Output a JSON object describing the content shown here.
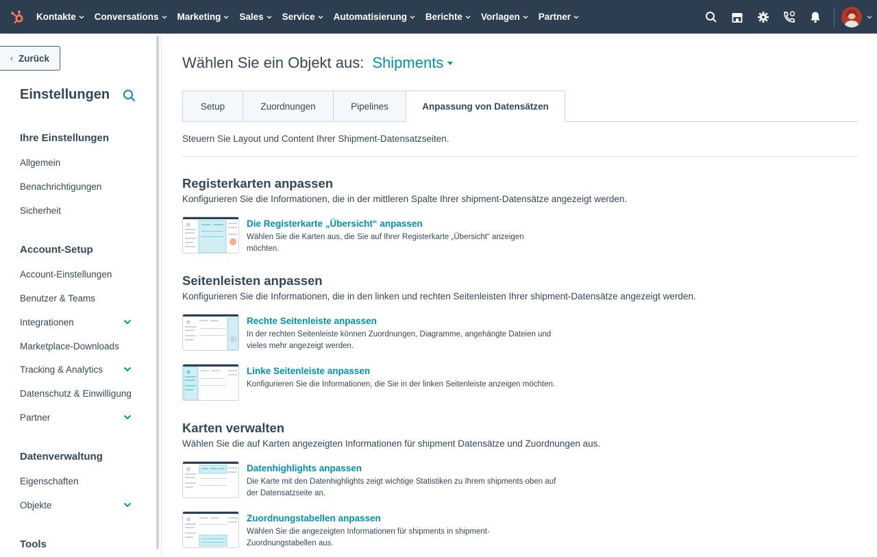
{
  "topnav": {
    "items": [
      "Kontakte",
      "Conversations",
      "Marketing",
      "Sales",
      "Service",
      "Automatisierung",
      "Berichte",
      "Vorlagen",
      "Partner"
    ]
  },
  "sidebar": {
    "back_label": "Zurück",
    "title": "Einstellungen",
    "sections": [
      {
        "title": "Ihre Einstellungen",
        "items": [
          "Allgemein",
          "Benachrichtigungen",
          "Sicherheit"
        ]
      },
      {
        "title": "Account-Setup",
        "items": [
          "Account-Einstellungen",
          "Benutzer & Teams",
          "Integrationen",
          "Marketplace-Downloads",
          "Tracking & Analytics",
          "Datenschutz & Einwilligung",
          "Partner"
        ]
      },
      {
        "title": "Datenverwaltung",
        "items": [
          "Eigenschaften",
          "Objekte"
        ]
      },
      {
        "title": "Tools",
        "items": []
      }
    ]
  },
  "main": {
    "title_prefix": "Wählen Sie ein Objekt aus:",
    "object": "Shipments",
    "tabs": [
      "Setup",
      "Zuordnungen",
      "Pipelines",
      "Anpassung von Datensätzen"
    ],
    "description": "Steuern Sie Layout und Content Ihrer Shipment-Datensatzseiten.",
    "sections": [
      {
        "title": "Registerkarten anpassen",
        "description": "Konfigurieren Sie die Informationen, die in der mittleren Spalte Ihrer shipment-Datensätze angezeigt werden.",
        "items": [
          {
            "link": "Die Registerkarte „Übersicht“ anpassen",
            "desc": "Wählen Sie die Karten aus, die Sie auf Ihrer Registerkarte „Übersicht“ anzeigen möchten."
          }
        ]
      },
      {
        "title": "Seitenleisten anpassen",
        "description": "Konfigurieren Sie die Informationen, die in den linken und rechten Seitenleisten Ihrer shipment-Datensätze angezeigt werden.",
        "items": [
          {
            "link": "Rechte Seitenleiste anpassen",
            "desc": "In der rechten Seitenleiste können Zuordnungen, Diagramme, angehängte Dateien und vieles mehr angezeigt werden."
          },
          {
            "link": "Linke Seitenleiste anpassen",
            "desc": "Konfigurieren Sie die Informationen, die Sie in der linken Seitenleiste anzeigen möchten."
          }
        ]
      },
      {
        "title": "Karten verwalten",
        "description": "Wählen Sie die auf Karten angezeigten Informationen für shipment Datensätze und Zuordnungen aus.",
        "items": [
          {
            "link": "Datenhighlights anpassen",
            "desc": "Die Karte mit den Datenhighlights zeigt wichtige Statistiken zu Ihrem shipments oben auf der Datensatzseite an."
          },
          {
            "link": "Zuordnungstabellen anpassen",
            "desc": "Wählen Sie die angezeigten Informationen für shipments in shipment-Zuordnungstabellen aus."
          }
        ]
      }
    ]
  },
  "colors": {
    "nav_bg": "#2d3e50",
    "link": "#0091ae",
    "text": "#33475b",
    "accent": "#ff7a59"
  }
}
